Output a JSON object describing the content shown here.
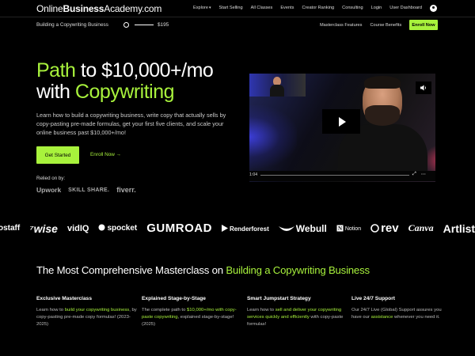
{
  "brand": {
    "logo_regular": "Online",
    "logo_bold": "Business",
    "logo_rest": "Academy.com"
  },
  "nav": {
    "items": [
      "Explore",
      "Start Selling",
      "All Classes",
      "Events",
      "Creator Ranking",
      "Consulting",
      "Login",
      "User Dashboard"
    ],
    "explore_chevron": "▾"
  },
  "subbar": {
    "course_title": "Building a Copywriting Business",
    "price": "$195",
    "links": [
      "Masterclass Features",
      "Course Benefits"
    ],
    "enroll_label": "Enroll Now"
  },
  "hero": {
    "line1_green": "Path",
    "line1_rest": " to $10,000+/mo",
    "line2_white": "with ",
    "line2_green": "Copywriting",
    "description": "Learn how to build a copywriting business, write copy that actually sells by copy-pasting pre-made formulas, get your first five clients, and scale your online business past $10,000+/mo!",
    "cta_primary": "Get Started",
    "cta_secondary": "Enroll Now →",
    "relied_on": "Relied on by:",
    "relied_logos": [
      "Upwork",
      "SKILL SHARE.",
      "fiverr."
    ]
  },
  "video": {
    "time": "1:04",
    "volume_icon": "volume-icon",
    "play_icon": "play-icon",
    "controls": [
      "⤢",
      "⋯"
    ]
  },
  "brands": [
    "ostaff",
    "wise",
    "vidIQ",
    "spocket",
    "GUMROAD",
    "Renderforest",
    "Webull",
    "Notion",
    "rev",
    "Canva",
    "Artlist"
  ],
  "section": {
    "title_white": "The Most Comprehensive Masterclass on ",
    "title_green": "Building a Copywriting Business",
    "features": [
      {
        "title": "Exclusive Masterclass",
        "pre": "Learn how to ",
        "green": "build your copywriting business",
        "post": ", by copy-pasting pre-made copy formulas! (2023-2025)"
      },
      {
        "title": "Explained Stage-by-Stage",
        "pre": "The complete path to ",
        "green": "$10,000+/mo with copy-paste copywriting",
        "post": ", explained stage-by-stage! (2025)"
      },
      {
        "title": "Smart Jumpstart Strategy",
        "pre": "Learn how to ",
        "green": "sell and deliver your copywriting services quickly and efficiently",
        "post": " with copy-paste formulas!"
      },
      {
        "title": "Live 24/7 Support",
        "pre": "Our 24/7 Live (Global) Support assures you have our ",
        "green": "assistance",
        "post": " whenever you need it."
      }
    ]
  },
  "colors": {
    "accent": "#a8f23c",
    "background": "#000000"
  }
}
